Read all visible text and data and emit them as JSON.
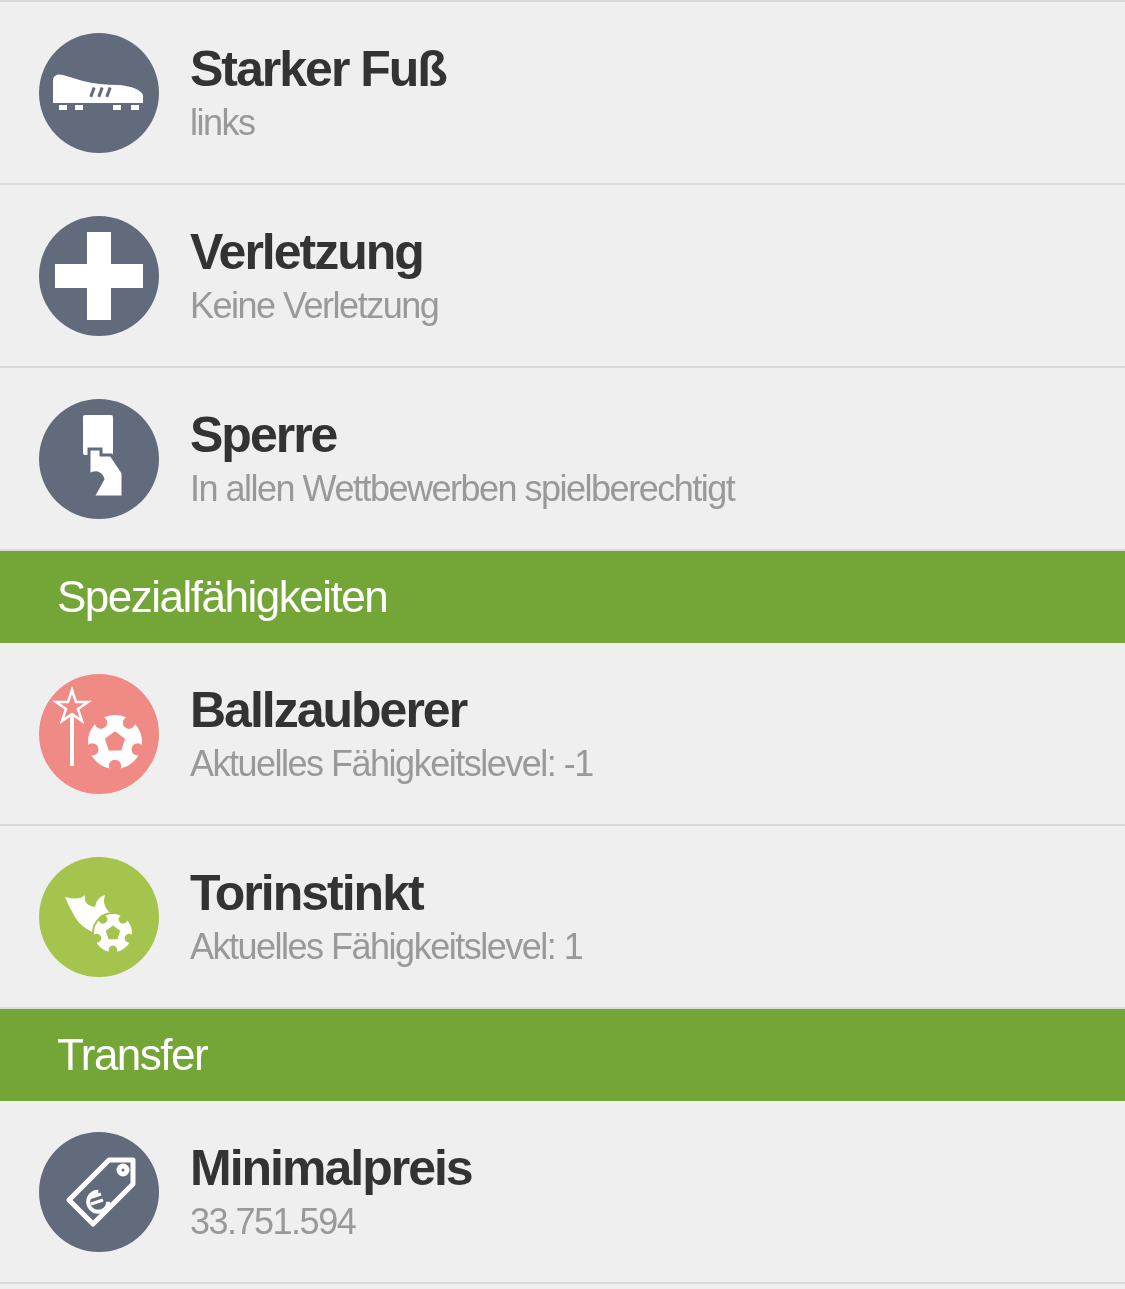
{
  "sections": [
    {
      "items": [
        {
          "kind": "boot",
          "color": "#626b7c",
          "title": "Starker Fuß",
          "subtitle": "links"
        },
        {
          "kind": "cross",
          "color": "#626b7c",
          "title": "Verletzung",
          "subtitle": "Keine Verletzung"
        },
        {
          "kind": "card",
          "color": "#626b7c",
          "title": "Sperre",
          "subtitle": "In allen Wettbewerben spielberechtigt"
        }
      ]
    },
    {
      "title": "Spezialfähigkeiten",
      "items": [
        {
          "kind": "wand",
          "color": "#f08a84",
          "title": "Ballzauberer",
          "subtitle": "Aktuelles Fähigkeitslevel: -1"
        },
        {
          "kind": "fire",
          "color": "#a5c44e",
          "title": "Torinstinkt",
          "subtitle": "Aktuelles Fähigkeitslevel: 1"
        }
      ]
    },
    {
      "title": "Transfer",
      "items": [
        {
          "kind": "tag",
          "color": "#626b7c",
          "title": "Minimalpreis",
          "subtitle": "33.751.594"
        }
      ]
    }
  ]
}
